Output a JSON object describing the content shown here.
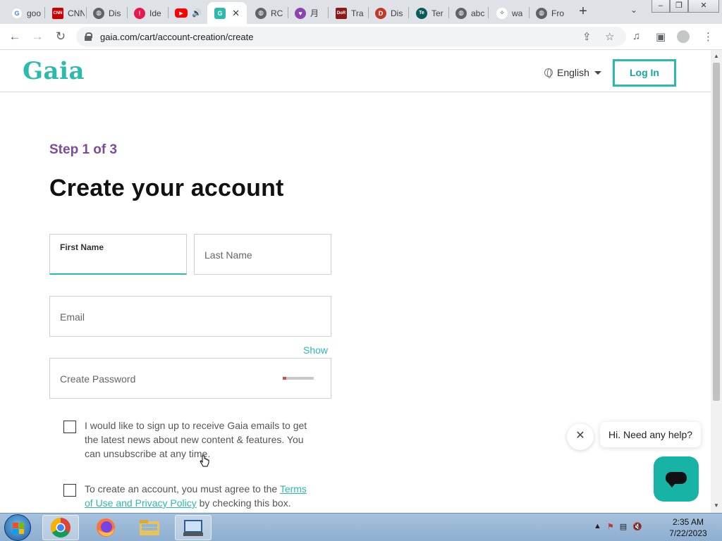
{
  "browser": {
    "tabs": [
      {
        "title": "goo",
        "icon": "google-icon",
        "color": "#4285f4"
      },
      {
        "title": "CNN",
        "icon": "cnn-icon",
        "color": "#cc0000"
      },
      {
        "title": "Dis",
        "icon": "globe-icon",
        "color": "#5f6368"
      },
      {
        "title": "Ide",
        "icon": "idea-icon",
        "color": "#e8174d"
      },
      {
        "title": "",
        "icon": "youtube-icon",
        "color": "#ff0000"
      },
      {
        "title": "",
        "icon": "gaia-icon",
        "color": "#2bbbad"
      },
      {
        "title": "RC",
        "icon": "globe-icon",
        "color": "#5f6368"
      },
      {
        "title": "月",
        "icon": "heart-icon",
        "color": "#8e44ad"
      },
      {
        "title": "Tra",
        "icon": "dor-icon",
        "color": "#8b1a1a"
      },
      {
        "title": "Dis",
        "icon": "dis-icon",
        "color": "#c0392b"
      },
      {
        "title": "Ter",
        "icon": "ter-icon",
        "color": "#0b5a5a"
      },
      {
        "title": "abc",
        "icon": "globe-icon",
        "color": "#5f6368"
      },
      {
        "title": "wa",
        "icon": "wa-icon",
        "color": "#333333"
      },
      {
        "title": "Fro",
        "icon": "globe-icon",
        "color": "#5f6368"
      }
    ],
    "url": "gaia.com/cart/account-creation/create"
  },
  "site": {
    "logo": "Gaia",
    "language": "English",
    "login_label": "Log In"
  },
  "form": {
    "step": "Step 1 of 3",
    "title": "Create your account",
    "first_name_label": "First Name",
    "last_name_placeholder": "Last Name",
    "email_placeholder": "Email",
    "show_label": "Show",
    "password_placeholder": "Create Password",
    "newsletter_text": "I would like to sign up to receive Gaia emails to get the latest news about new content & features. You can unsubscribe at any time.",
    "terms_prefix": "To create an account, you must agree to the ",
    "terms_link": "Terms of Use and Privacy Policy",
    "terms_suffix": " by checking this box."
  },
  "chat": {
    "message": "Hi. Need any help?"
  },
  "taskbar": {
    "time": "2:35 AM",
    "date": "7/22/2023"
  },
  "colors": {
    "brand": "#2bbbad",
    "step": "#7b4c9c"
  }
}
